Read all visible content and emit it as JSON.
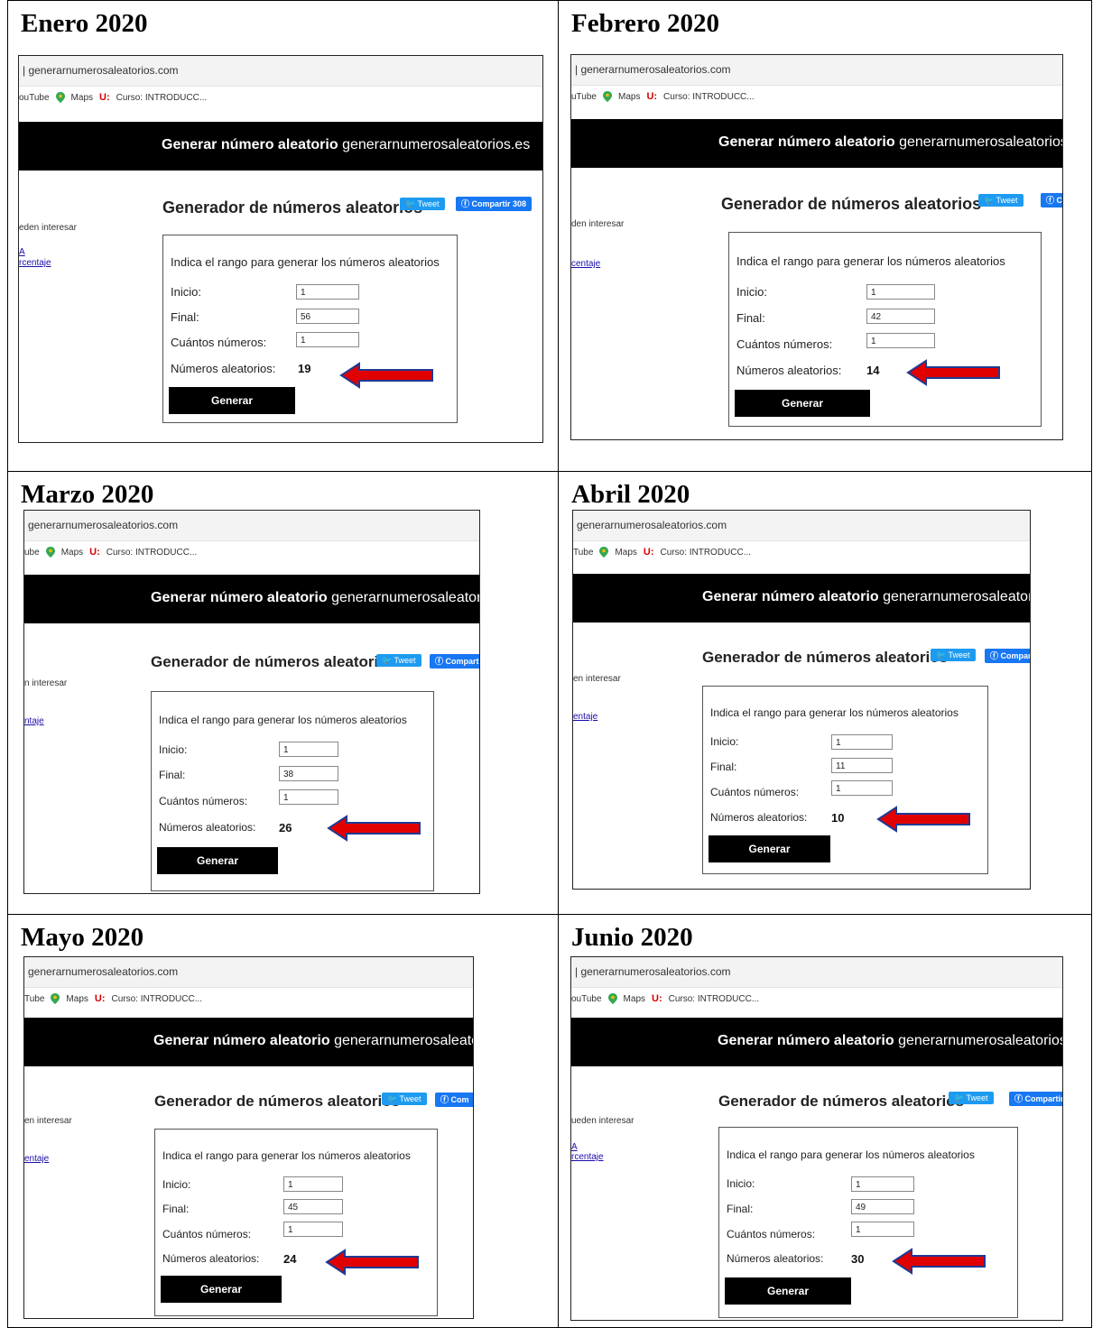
{
  "panels": [
    {
      "month": "Enero 2020",
      "url": "generarnumerosaleatorios.com",
      "bookmark_left": "ouTube",
      "maps": "Maps",
      "course": "Curso: INTRODUCC...",
      "banner_bold": "Generar número aleatorio",
      "banner_site": "generarnumerosaleatorios.es",
      "title": "Generador de números aleatorios",
      "tweet": "Tweet",
      "share": "Compartir 308",
      "side_text": "eden interesar",
      "side_link1": "A",
      "side_link2": "rcentaje",
      "intro": "Indica el rango para generar los números aleatorios",
      "inicio_label": "Inicio:",
      "inicio_value": "1",
      "final_label": "Final:",
      "final_value": "56",
      "cuantos_label": "Cuántos números:",
      "cuantos_value": "1",
      "resultado_label": "Números aleatorios:",
      "resultado_value": "19",
      "button": "Generar"
    },
    {
      "month": "Febrero 2020",
      "url": "generarnumerosaleatorios.com",
      "bookmark_left": "uTube",
      "maps": "Maps",
      "course": "Curso: INTRODUCC...",
      "banner_bold": "Generar número aleatorio",
      "banner_site": "generarnumerosaleatorios.",
      "title": "Generador de números aleatorios",
      "tweet": "Tweet",
      "share": "C",
      "side_text": "den interesar",
      "side_link1": "",
      "side_link2": "centaje",
      "intro": "Indica el rango para generar los números aleatorios",
      "inicio_label": "Inicio:",
      "inicio_value": "1",
      "final_label": "Final:",
      "final_value": "42",
      "cuantos_label": "Cuántos números:",
      "cuantos_value": "1",
      "resultado_label": "Números aleatorios:",
      "resultado_value": "14",
      "button": "Generar"
    },
    {
      "month": "Marzo 2020",
      "url": "generarnumerosaleatorios.com",
      "bookmark_left": "ube",
      "maps": "Maps",
      "course": "Curso: INTRODUCC...",
      "banner_bold": "Generar número aleatorio",
      "banner_site": "generarnumerosaleatorios.es",
      "title": "Generador de números aleatorios",
      "tweet": "Tweet",
      "share": "Compartir",
      "side_text": "n interesar",
      "side_link1": "",
      "side_link2": "ntaje",
      "intro": "Indica el rango para generar los números aleatorios",
      "inicio_label": "Inicio:",
      "inicio_value": "1",
      "final_label": "Final:",
      "final_value": "38",
      "cuantos_label": "Cuántos números:",
      "cuantos_value": "1",
      "resultado_label": "Números aleatorios:",
      "resultado_value": "26",
      "button": "Generar"
    },
    {
      "month": "Abril 2020",
      "url": "generarnumerosaleatorios.com",
      "bookmark_left": "Tube",
      "maps": "Maps",
      "course": "Curso: INTRODUCC...",
      "banner_bold": "Generar número aleatorio",
      "banner_site": "generarnumerosaleatorios.es",
      "title": "Generador de números aleatorios",
      "tweet": "Tweet",
      "share": "Compar",
      "side_text": "en interesar",
      "side_link1": "",
      "side_link2": "entaje",
      "intro": "Indica el rango para generar los números aleatorios",
      "inicio_label": "Inicio:",
      "inicio_value": "1",
      "final_label": "Final:",
      "final_value": "11",
      "cuantos_label": "Cuántos números:",
      "cuantos_value": "1",
      "resultado_label": "Números aleatorios:",
      "resultado_value": "10",
      "button": "Generar"
    },
    {
      "month": "Mayo 2020",
      "url": "generarnumerosaleatorios.com",
      "bookmark_left": "Tube",
      "maps": "Maps",
      "course": "Curso: INTRODUCC...",
      "banner_bold": "Generar número aleatorio",
      "banner_site": "generarnumerosaleatorios.es",
      "title": "Generador de números aleatorios",
      "tweet": "Tweet",
      "share": "Com",
      "side_text": "en interesar",
      "side_link1": "",
      "side_link2": "entaje",
      "intro": "Indica el rango para generar los números aleatorios",
      "inicio_label": "Inicio:",
      "inicio_value": "1",
      "final_label": "Final:",
      "final_value": "45",
      "cuantos_label": "Cuántos números:",
      "cuantos_value": "1",
      "resultado_label": "Números aleatorios:",
      "resultado_value": "24",
      "button": "Generar"
    },
    {
      "month": "Junio 2020",
      "url": "generarnumerosaleatorios.com",
      "bookmark_left": "ouTube",
      "maps": "Maps",
      "course": "Curso: INTRODUCC...",
      "banner_bold": "Generar número aleatorio",
      "banner_site": "generarnumerosaleatorios.es",
      "title": "Generador de números aleatorios",
      "tweet": "Tweet",
      "share": "Compartir",
      "side_text": "ueden interesar",
      "side_link1": "A",
      "side_link2": "rcentaje",
      "intro": "Indica el rango para generar los números aleatorios",
      "inicio_label": "Inicio:",
      "inicio_value": "1",
      "final_label": "Final:",
      "final_value": "49",
      "cuantos_label": "Cuántos números:",
      "cuantos_value": "1",
      "resultado_label": "Números aleatorios:",
      "resultado_value": "30",
      "button": "Generar"
    }
  ],
  "colors": {
    "arrow": "#e00000",
    "arrow_outline": "#1f3a93",
    "banner": "#000000",
    "tweet": "#1d9bf0",
    "share": "#1877f2"
  }
}
